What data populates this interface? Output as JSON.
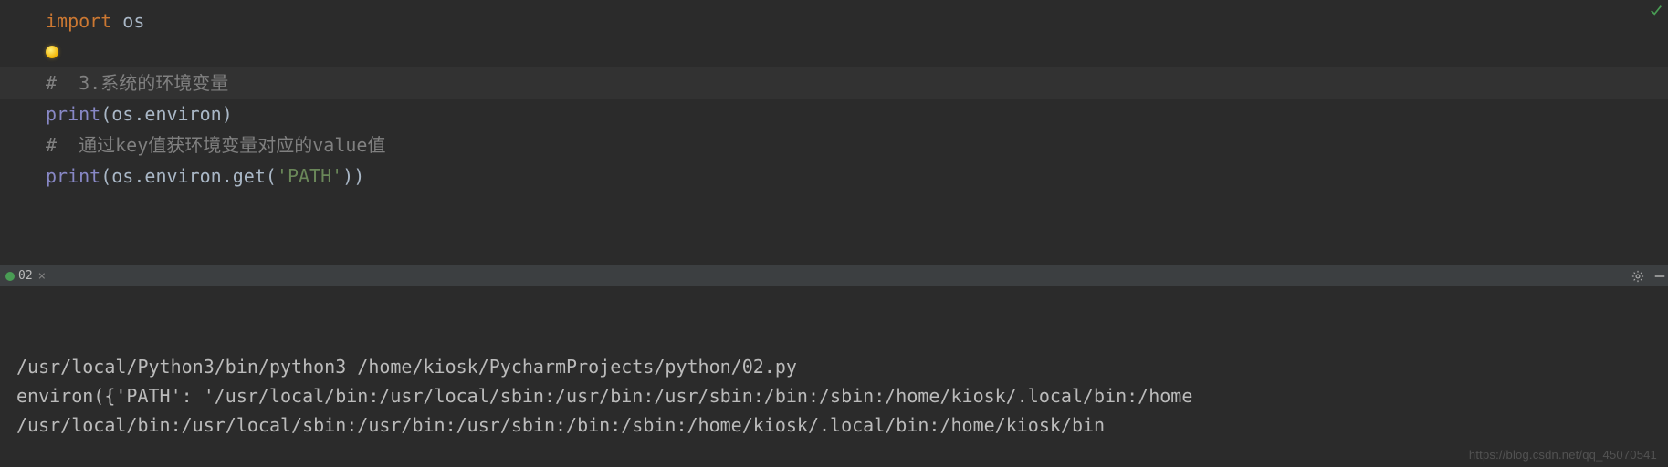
{
  "editor": {
    "lines": [
      {
        "type": "code",
        "tokens": [
          {
            "cls": "tok-kw",
            "t": "import "
          },
          {
            "cls": "tok-id",
            "t": "os"
          }
        ]
      },
      {
        "type": "blank"
      },
      {
        "type": "comment-hl",
        "tokens": [
          {
            "cls": "tok-comment",
            "t": "#  3.系统的环境变量"
          }
        ]
      },
      {
        "type": "code",
        "tokens": [
          {
            "cls": "tok-builtin",
            "t": "print"
          },
          {
            "cls": "tok-punc",
            "t": "("
          },
          {
            "cls": "tok-id",
            "t": "os"
          },
          {
            "cls": "tok-punc",
            "t": "."
          },
          {
            "cls": "tok-attr",
            "t": "environ"
          },
          {
            "cls": "tok-punc",
            "t": ")"
          }
        ]
      },
      {
        "type": "code",
        "tokens": [
          {
            "cls": "tok-comment",
            "t": "#  通过key值获环境变量对应的value值"
          }
        ]
      },
      {
        "type": "code",
        "tokens": [
          {
            "cls": "tok-builtin",
            "t": "print"
          },
          {
            "cls": "tok-punc",
            "t": "("
          },
          {
            "cls": "tok-id",
            "t": "os"
          },
          {
            "cls": "tok-punc",
            "t": "."
          },
          {
            "cls": "tok-attr",
            "t": "environ"
          },
          {
            "cls": "tok-punc",
            "t": "."
          },
          {
            "cls": "tok-attr",
            "t": "get"
          },
          {
            "cls": "tok-punc",
            "t": "("
          },
          {
            "cls": "tok-str",
            "t": "'PATH'"
          },
          {
            "cls": "tok-punc",
            "t": ")"
          },
          {
            "cls": "tok-punc",
            "t": ")"
          }
        ]
      }
    ]
  },
  "run_tab": {
    "label": "02",
    "close_glyph": "×"
  },
  "console": {
    "lines": [
      "/usr/local/Python3/bin/python3 /home/kiosk/PycharmProjects/python/02.py",
      "environ({'PATH': '/usr/local/bin:/usr/local/sbin:/usr/bin:/usr/sbin:/bin:/sbin:/home/kiosk/.local/bin:/home",
      "/usr/local/bin:/usr/local/sbin:/usr/bin:/usr/sbin:/bin:/sbin:/home/kiosk/.local/bin:/home/kiosk/bin"
    ]
  },
  "watermark": "https://blog.csdn.net/qq_45070541"
}
